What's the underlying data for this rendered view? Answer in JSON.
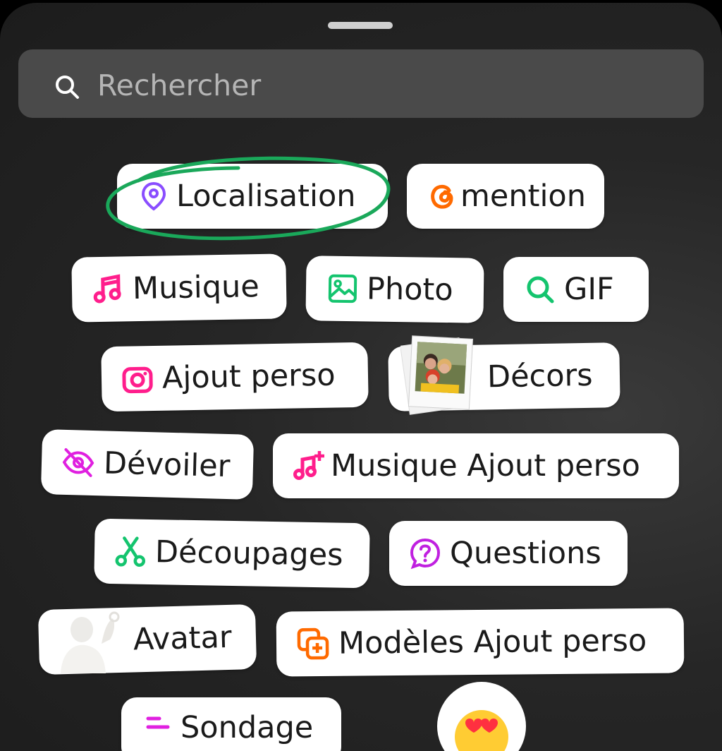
{
  "search": {
    "placeholder": "Rechercher",
    "icon": "search-icon"
  },
  "stickers": {
    "location": "Localisation",
    "mention": "mention",
    "music": "Musique",
    "photo": "Photo",
    "gif": "GIF",
    "add_yours": "Ajout perso",
    "frames": "Décors",
    "reveal": "Dévoiler",
    "music_add_yours": "Musique Ajout perso",
    "cutouts": "Découpages",
    "questions": "Questions",
    "avatar": "Avatar",
    "templates_add_yours": "Modèles Ajout perso",
    "poll": "Sondage"
  },
  "colors": {
    "location": "#8a4dff",
    "mention": "#ff6a00",
    "music": "#ff1e8c",
    "photo": "#14c46e",
    "gif": "#14c46e",
    "add_yours": "#ff1e8c",
    "reveal": "#e020e0",
    "music_add_yours": "#ff1e8c",
    "cutouts": "#14c46e",
    "questions": "#c020e0",
    "templates": "#ff6a00",
    "highlight": "#1aa85a"
  }
}
